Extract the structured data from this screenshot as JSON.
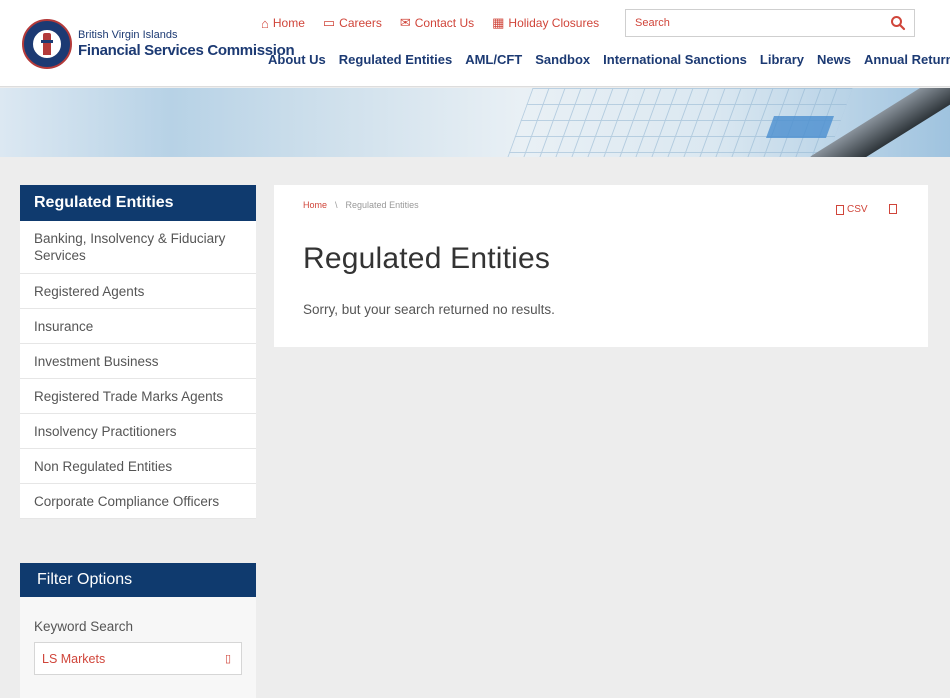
{
  "logo": {
    "line1": "British Virgin Islands",
    "line2": "Financial Services Commission"
  },
  "utility_nav": [
    {
      "label": "Home",
      "icon": "home-icon"
    },
    {
      "label": "Careers",
      "icon": "briefcase-icon"
    },
    {
      "label": "Contact Us",
      "icon": "envelope-icon"
    },
    {
      "label": "Holiday Closures",
      "icon": "calendar-icon"
    }
  ],
  "search": {
    "placeholder": "Search",
    "icon": "search-icon"
  },
  "main_nav": [
    "About Us",
    "Regulated Entities",
    "AML/CFT",
    "Sandbox",
    "International Sanctions",
    "Library",
    "News",
    "Annual Returns"
  ],
  "sidebar": {
    "title": "Regulated Entities",
    "items": [
      "Banking, Insolvency & Fiduciary Services",
      "Registered Agents",
      "Insurance",
      "Investment Business",
      "Registered Trade Marks Agents",
      "Insolvency Practitioners",
      "Non Regulated Entities",
      "Corporate Compliance Officers"
    ]
  },
  "filter": {
    "title": "Filter Options",
    "keyword_label": "Keyword Search",
    "keyword_value": "LS Markets"
  },
  "content": {
    "breadcrumb": {
      "home": "Home",
      "separator": "\\",
      "current": "Regulated Entities"
    },
    "csv_label": "CSV",
    "title": "Regulated Entities",
    "message": "Sorry, but your search returned no results."
  },
  "colors": {
    "accent": "#d0453a",
    "navy": "#0f3a6e",
    "page_bg": "#ededed"
  }
}
